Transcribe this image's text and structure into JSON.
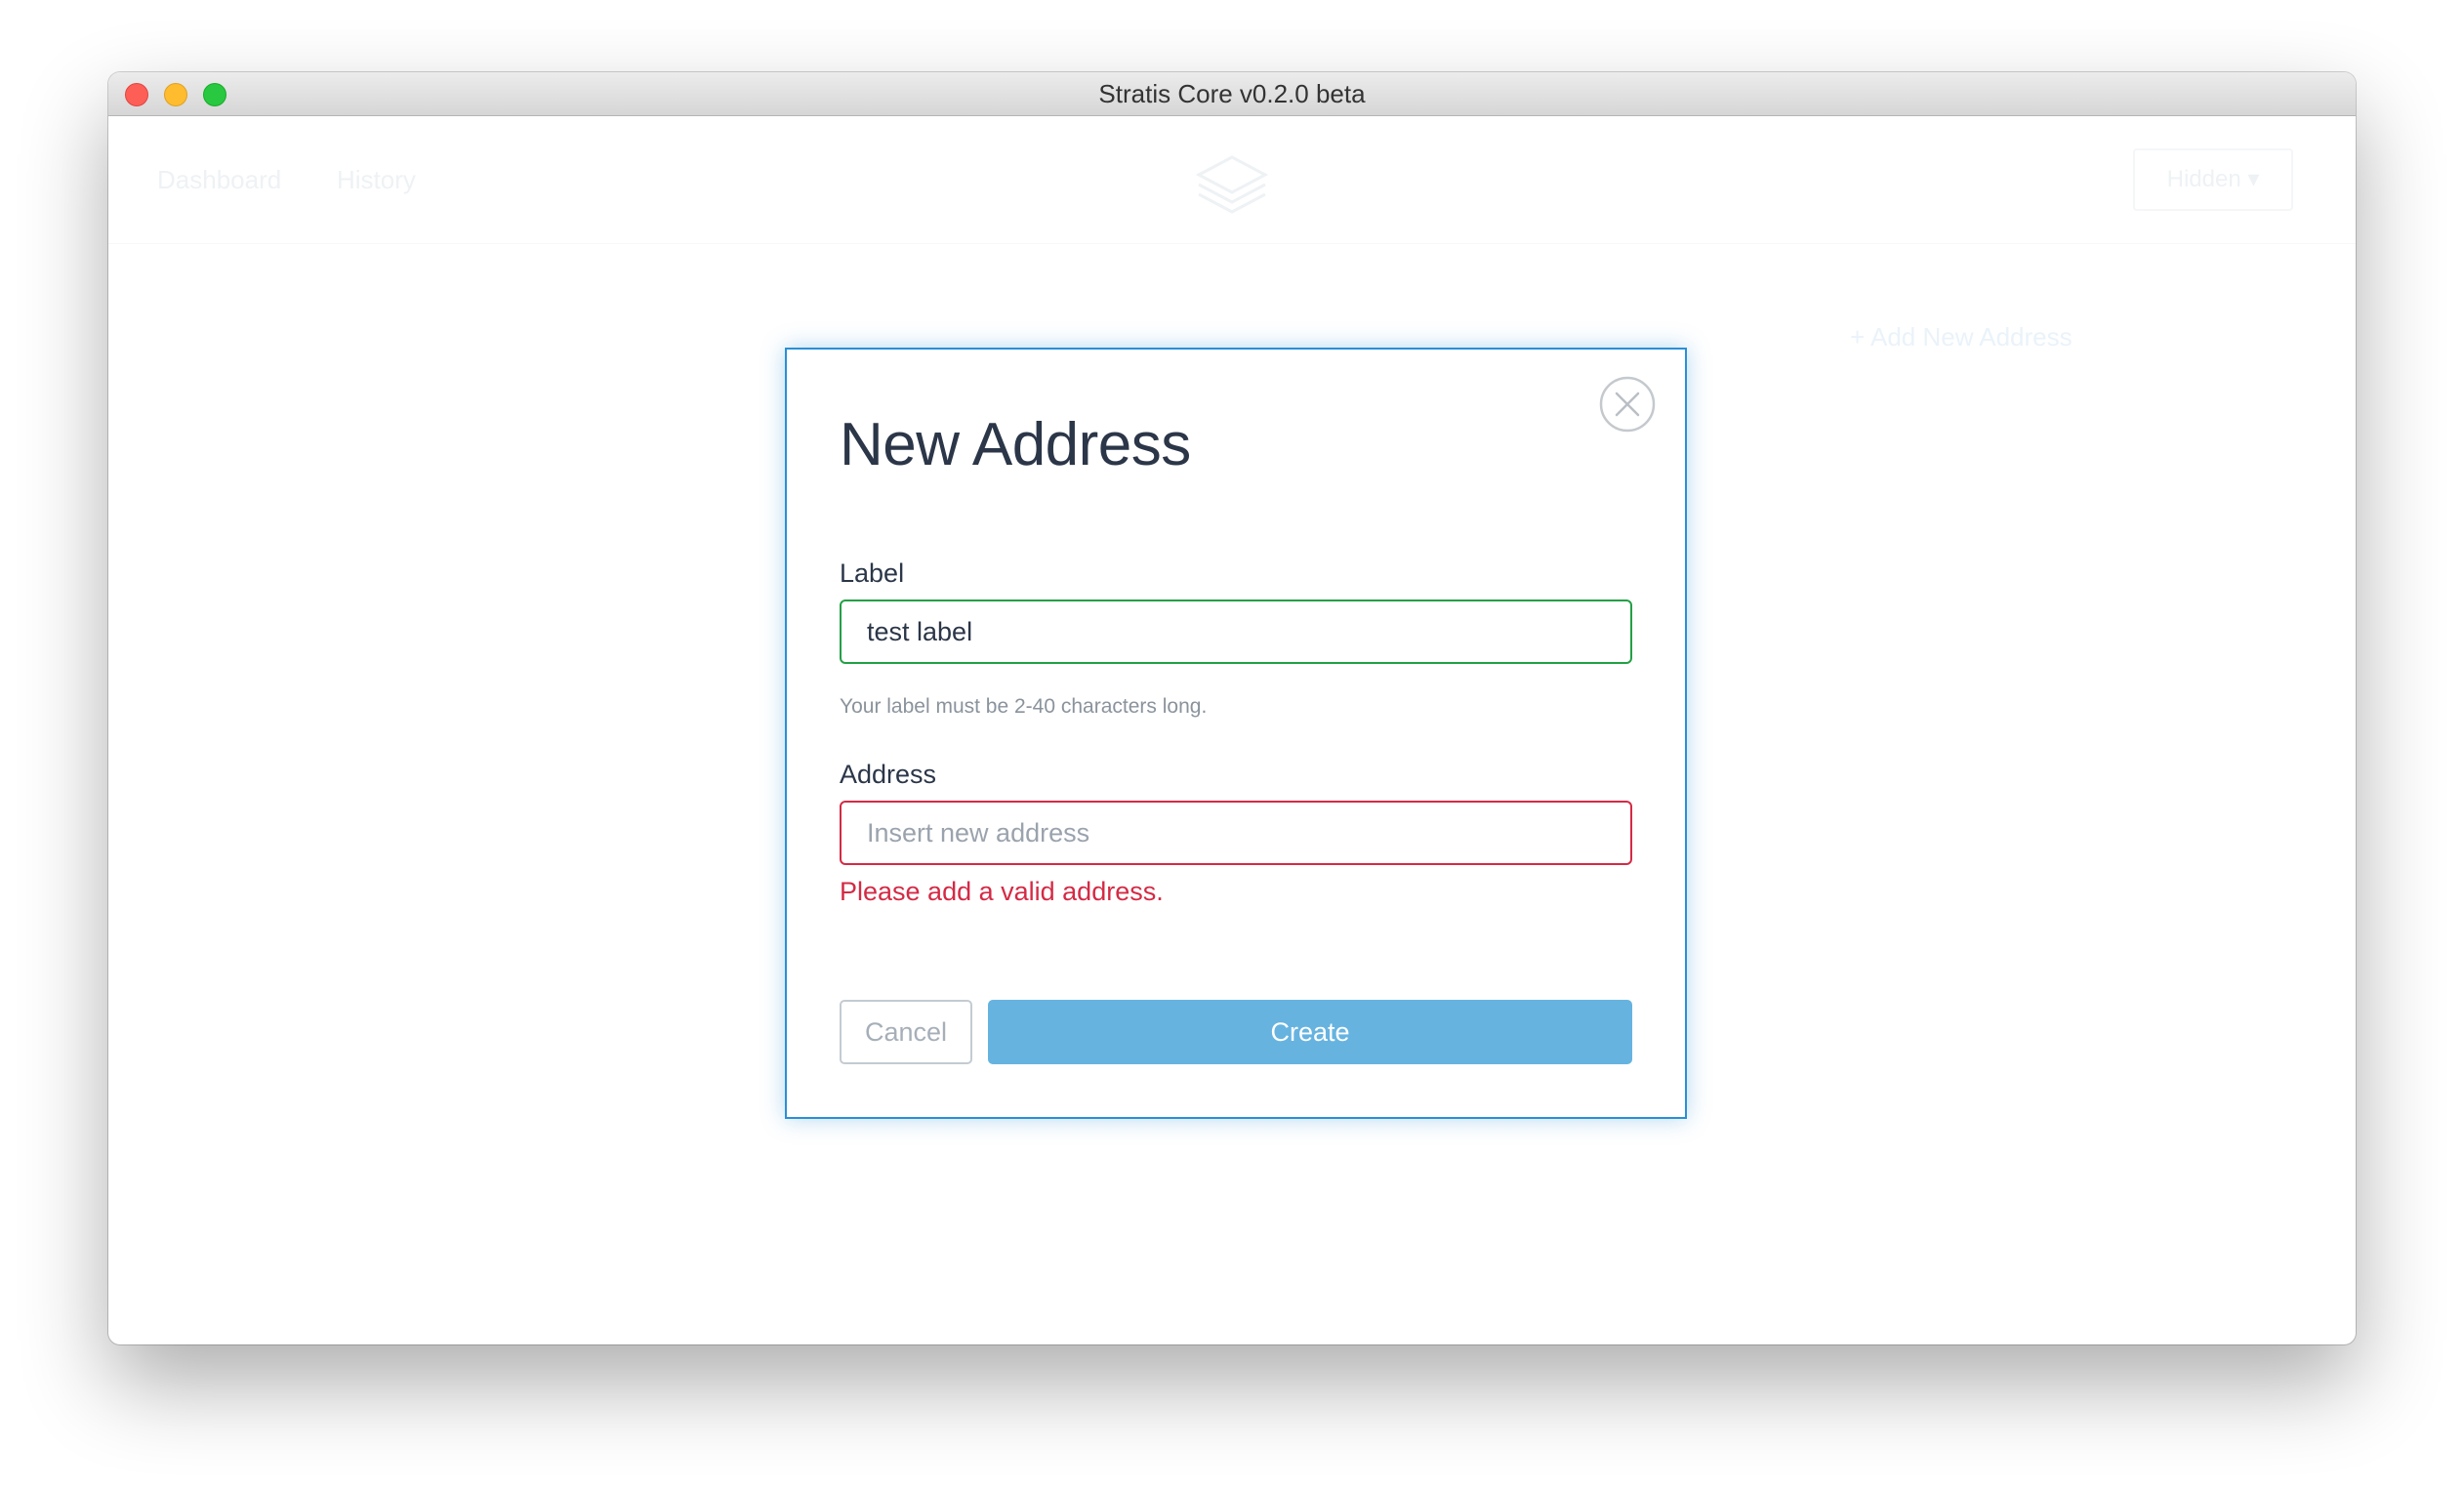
{
  "window": {
    "title": "Stratis Core v0.2.0 beta"
  },
  "background_app": {
    "nav_items": [
      "Dashboard",
      "History"
    ],
    "wallet_dropdown": "Hidden ▾",
    "add_address_link": "+ Add New Address"
  },
  "modal": {
    "title": "New Address",
    "label_field": {
      "label": "Label",
      "value": "test label",
      "hint": "Your label must be 2-40 characters long.",
      "state": "valid"
    },
    "address_field": {
      "label": "Address",
      "value": "",
      "placeholder": "Insert new address",
      "error": "Please add a valid address.",
      "state": "invalid"
    },
    "cancel_label": "Cancel",
    "create_label": "Create"
  },
  "colors": {
    "modal_border": "#2a8fd6",
    "valid": "#23a045",
    "invalid": "#d42a45",
    "primary_button": "#66b3e0",
    "heading_text": "#2b3648"
  },
  "icons": {
    "close": "close-circle-icon",
    "logo": "stratis-layers-logo-icon"
  }
}
